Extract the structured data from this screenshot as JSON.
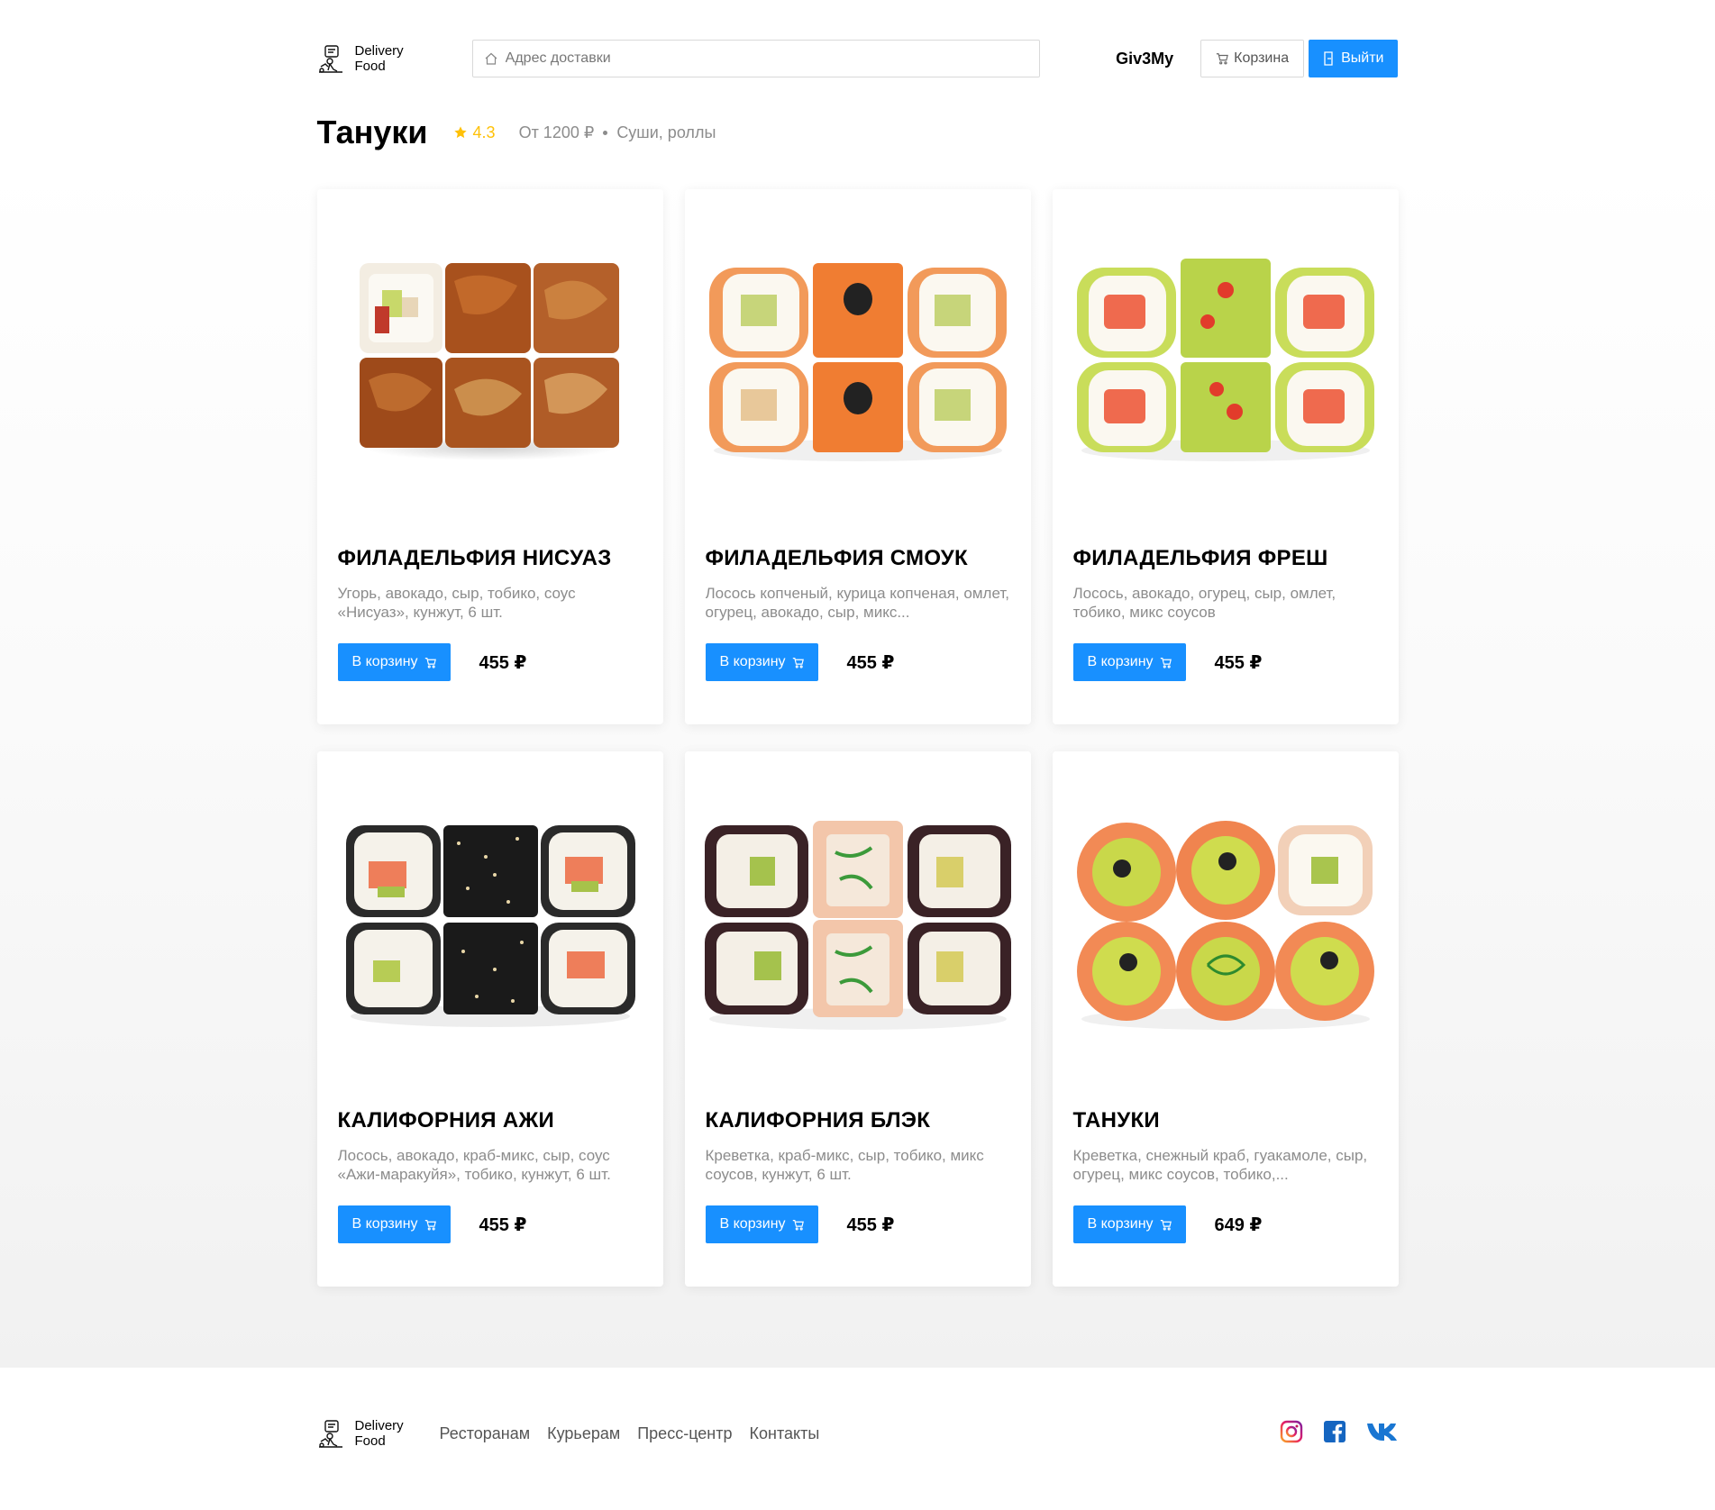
{
  "header": {
    "logo_line1": "Delivery",
    "logo_line2": "Food",
    "search_placeholder": "Адрес доставки",
    "user_name": "Giv3My",
    "cart_label": "Корзина",
    "logout_label": "Выйти"
  },
  "restaurant": {
    "name": "Тануки",
    "rating": "4.3",
    "price_from": "От 1200 ₽",
    "category": "Суши, роллы"
  },
  "products": [
    {
      "title": "ФИЛАДЕЛЬФИЯ НИСУАЗ",
      "description": "Угорь, авокадо, сыр, тобико, соус «Нисуаз», кунжут, 6 шт.",
      "button": "В корзину",
      "price": "455 ₽"
    },
    {
      "title": "ФИЛАДЕЛЬФИЯ СМОУК",
      "description": "Лосось копченый, курица копченая, омлет, огурец, авокадо, сыр, микс...",
      "button": "В корзину",
      "price": "455 ₽"
    },
    {
      "title": "ФИЛАДЕЛЬФИЯ ФРЕШ",
      "description": "Лосось, авокадо, огурец, сыр, омлет, тобико, микс соусов",
      "button": "В корзину",
      "price": "455 ₽"
    },
    {
      "title": "КАЛИФОРНИЯ АЖИ",
      "description": "Лосось, авокадо, краб-микс, сыр, соус «Ажи-маракуйя», тобико, кунжут, 6 шт.",
      "button": "В корзину",
      "price": "455 ₽"
    },
    {
      "title": "КАЛИФОРНИЯ БЛЭК",
      "description": "Креветка, краб-микс, сыр, тобико, микс соусов, кунжут, 6 шт.",
      "button": "В корзину",
      "price": "455 ₽"
    },
    {
      "title": "ТАНУКИ",
      "description": "Креветка, снежный краб, гуакамоле, сыр, огурец, микс соусов, тобико,...",
      "button": "В корзину",
      "price": "649 ₽"
    }
  ],
  "footer": {
    "logo_line1": "Delivery",
    "logo_line2": "Food",
    "links": [
      "Ресторанам",
      "Курьерам",
      "Пресс-центр",
      "Контакты"
    ],
    "social_icons": [
      "instagram-icon",
      "facebook-icon",
      "vk-icon"
    ]
  },
  "colors": {
    "accent": "#1890ff",
    "rating": "#ffc107",
    "muted_text": "#8c8c8c"
  }
}
